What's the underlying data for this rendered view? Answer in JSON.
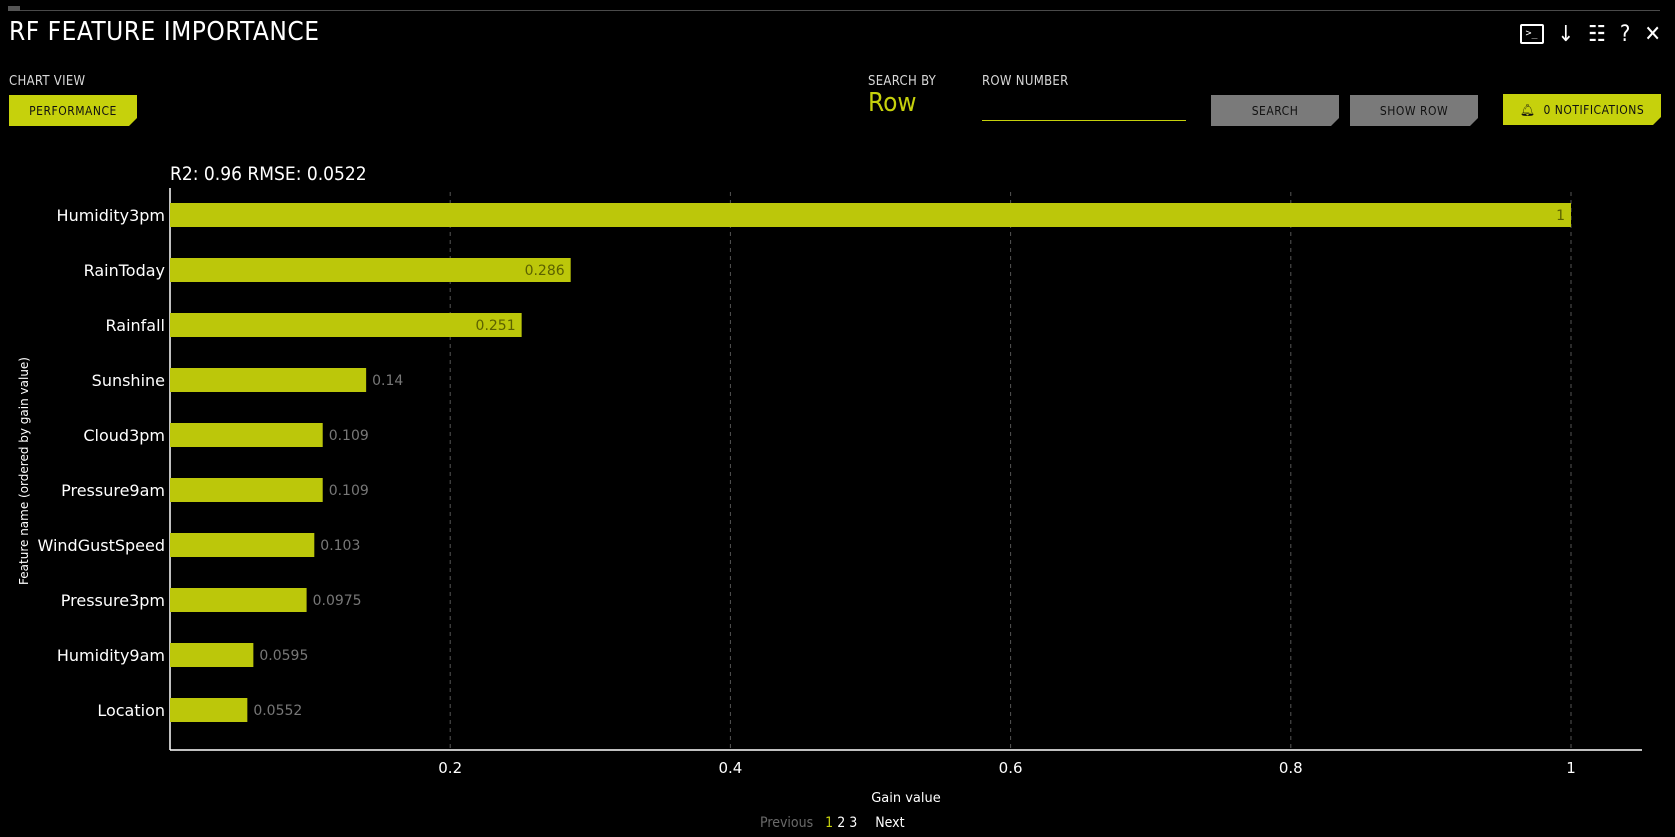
{
  "window": {
    "title": "RF FEATURE IMPORTANCE"
  },
  "controls": {
    "chart_view_label": "CHART VIEW",
    "chart_view_button": "PERFORMANCE",
    "search_by_label": "SEARCH BY",
    "search_by_value": "Row",
    "row_number_label": "ROW NUMBER",
    "row_number_value": "",
    "search_button": "SEARCH",
    "show_row_button": "SHOW ROW",
    "notifications_button": "0 NOTIFICATIONS"
  },
  "icons": {
    "terminal": "terminal-icon",
    "download": "download-icon",
    "list": "list-icon",
    "help": "help-icon",
    "close": "close-icon",
    "bell": "bell-icon"
  },
  "colors": {
    "accent": "#c6d10c",
    "bar": "#bcc70a",
    "background": "#000000"
  },
  "metrics_text": "R2: 0.96 RMSE: 0.0522",
  "chart_data": {
    "type": "bar",
    "orientation": "horizontal",
    "categories": [
      "Humidity3pm",
      "RainToday",
      "Rainfall",
      "Sunshine",
      "Cloud3pm",
      "Pressure9am",
      "WindGustSpeed",
      "Pressure3pm",
      "Humidity9am",
      "Location"
    ],
    "values": [
      1,
      0.286,
      0.251,
      0.14,
      0.109,
      0.109,
      0.103,
      0.0975,
      0.0595,
      0.0552
    ],
    "value_labels": [
      "1",
      "0.286",
      "0.251",
      "0.14",
      "0.109",
      "0.109",
      "0.103",
      "0.0975",
      "0.0595",
      "0.0552"
    ],
    "xlabel": "Gain value",
    "ylabel": "Feature name (ordered by gain value)",
    "xlim": [
      0,
      1.05
    ],
    "xticks": [
      0.2,
      0.4,
      0.6,
      0.8,
      1
    ],
    "xtick_labels": [
      "0.2",
      "0.4",
      "0.6",
      "0.8",
      "1"
    ],
    "grid": "vertical dashed"
  },
  "pagination": {
    "previous": "Previous",
    "pages": [
      "1",
      "2",
      "3"
    ],
    "active_page": "1",
    "next": "Next"
  }
}
